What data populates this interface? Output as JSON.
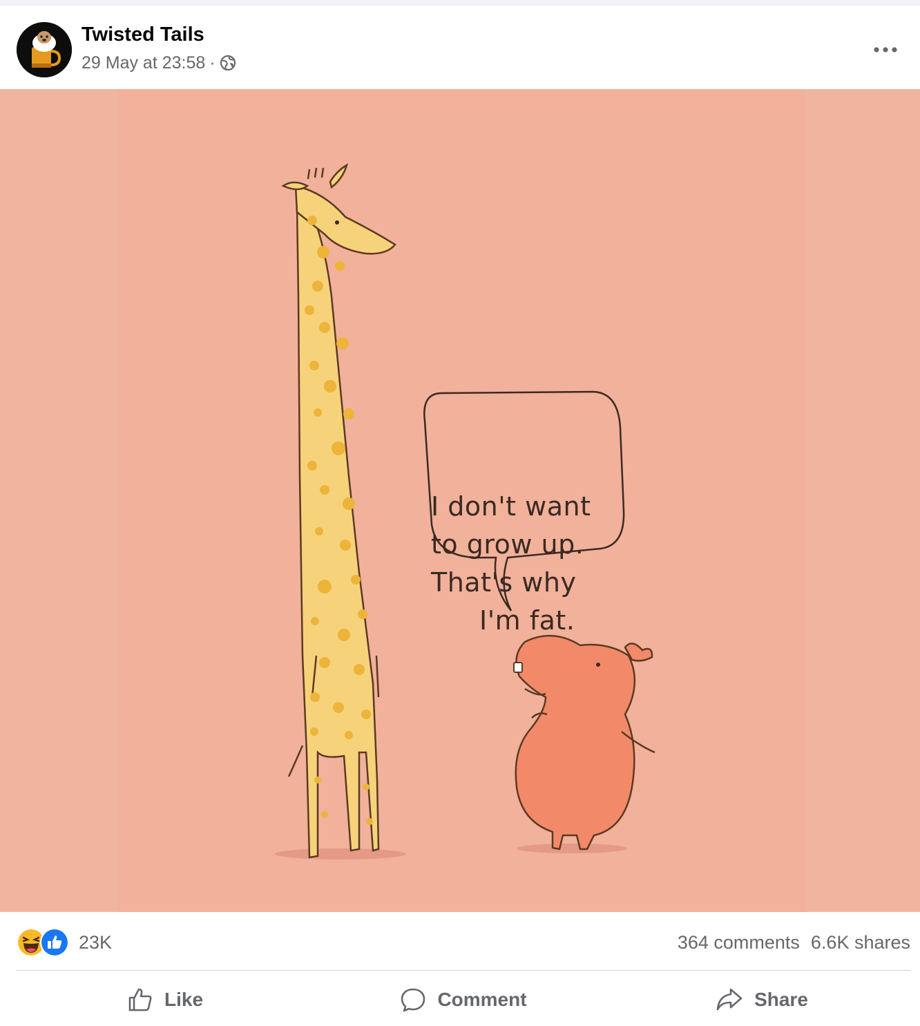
{
  "post": {
    "author": "Twisted Tails",
    "timestamp": "29 May at 23:58",
    "separator": "·",
    "privacy_icon": "globe-icon",
    "more_icon": "more-dots-icon"
  },
  "image": {
    "speech_bubble_lines": [
      "I don't want",
      "to grow up.",
      "That's why",
      "I'm fat."
    ],
    "background_color": "#f0b59f"
  },
  "reactions": {
    "icons": [
      "haha-reaction-icon",
      "like-reaction-icon"
    ],
    "count": "23K",
    "comments": "364 comments",
    "shares": "6.6K shares"
  },
  "actions": {
    "like": "Like",
    "comment": "Comment",
    "share": "Share"
  },
  "colors": {
    "secondary_text": "#65676b",
    "like_blue": "#1877f2",
    "haha_yellow": "#f7b928",
    "divider": "#ced0d4"
  }
}
